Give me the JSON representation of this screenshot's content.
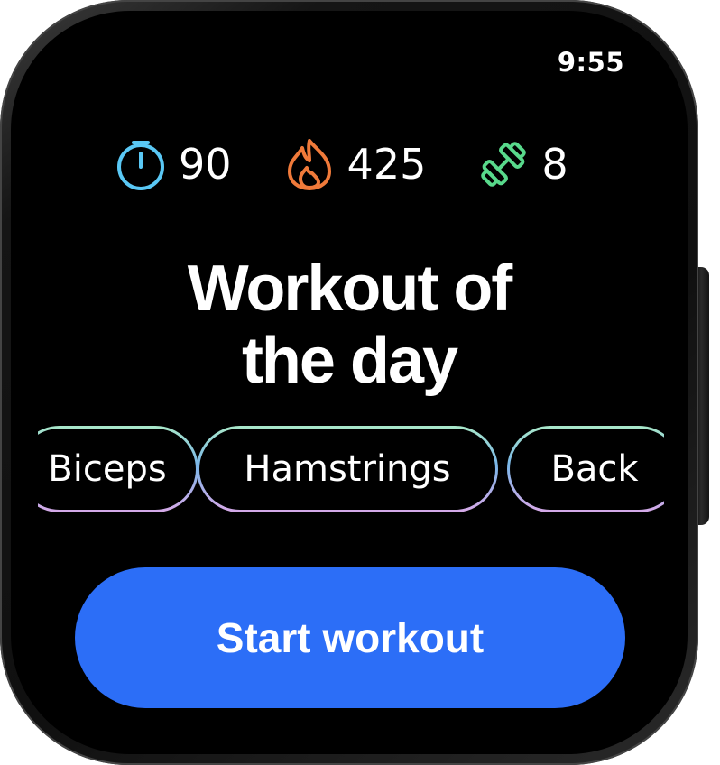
{
  "status": {
    "time": "9:55"
  },
  "stats": [
    {
      "icon": "stopwatch-icon",
      "value": "90",
      "color": "#5ac8f5"
    },
    {
      "icon": "flame-icon",
      "value": "425",
      "color": "#f07a3a"
    },
    {
      "icon": "dumbbell-icon",
      "value": "8",
      "color": "#58d98b"
    }
  ],
  "title": {
    "line1": "Workout of",
    "line2": "the day"
  },
  "chips": [
    "Biceps",
    "Hamstrings",
    "Back"
  ],
  "cta": {
    "label": "Start workout",
    "color": "#2c6ef7"
  }
}
